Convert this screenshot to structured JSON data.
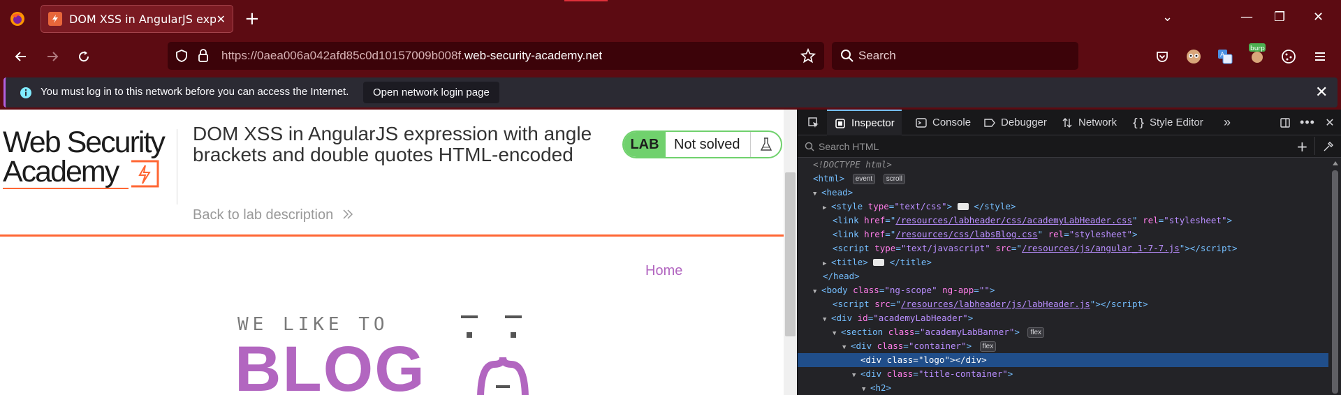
{
  "browser": {
    "tab_title": "DOM XSS in AngularJS expression",
    "url_prefix": "https://0aea006a042afd85c0d10157009b008f.",
    "url_domain": "web-security-academy.net",
    "search_placeholder": "Search",
    "icons": [
      "firefox-icon",
      "back-icon",
      "forward-icon",
      "reload-icon",
      "shield-icon",
      "lock-icon",
      "star-icon",
      "search-icon",
      "pocket-icon",
      "extension-icon",
      "translate-icon",
      "burp-icon",
      "cookie-icon",
      "menu-icon"
    ]
  },
  "notification": {
    "message": "You must log in to this network before you can access the Internet.",
    "button": "Open network login page"
  },
  "page": {
    "logo_line1": "Web Security",
    "logo_line2": "Academy",
    "lab_title": "DOM XSS in AngularJS expression with angle brackets and double quotes HTML-encoded",
    "back_link": "Back to lab description",
    "badge_lab": "LAB",
    "badge_status": "Not solved",
    "home_link": "Home",
    "blog_tagline": "WE LIKE TO",
    "blog_word": "BLOG",
    "colors": {
      "accent": "#ff6633",
      "lab_green": "#70d16d",
      "blog_purple": "#b266c0"
    }
  },
  "devtools": {
    "tabs": [
      "Inspector",
      "Console",
      "Debugger",
      "Network",
      "Style Editor"
    ],
    "search_placeholder": "Search HTML",
    "tree": {
      "doctype": "<!DOCTYPE html>",
      "html_open": "<html>",
      "badge_event": "event",
      "badge_scroll": "scroll",
      "badge_flex": "flex",
      "head_open": "<head>",
      "style_tag_open": "<style",
      "style_attr": "type",
      "style_val": "\"text/css\"",
      "style_close": "</style>",
      "link1_href": "/resources/labheader/css/academyLabHeader.css",
      "link2_href": "/resources/css/labsBlog.css",
      "script_src": "/resources/js/angular_1-7-7.js",
      "title_close": "</title>",
      "head_close": "</head>",
      "body_class": "\"ng-scope\"",
      "body_ngapp": "\"\"",
      "labheader_src": "/resources/labheader/js/labHeader.js",
      "div_id": "\"academyLabHeader\"",
      "section_class": "\"academyLabBanner\"",
      "container_class": "\"container\"",
      "logo_class": "\"logo\"",
      "title_container_class": "\"title-container\""
    }
  }
}
